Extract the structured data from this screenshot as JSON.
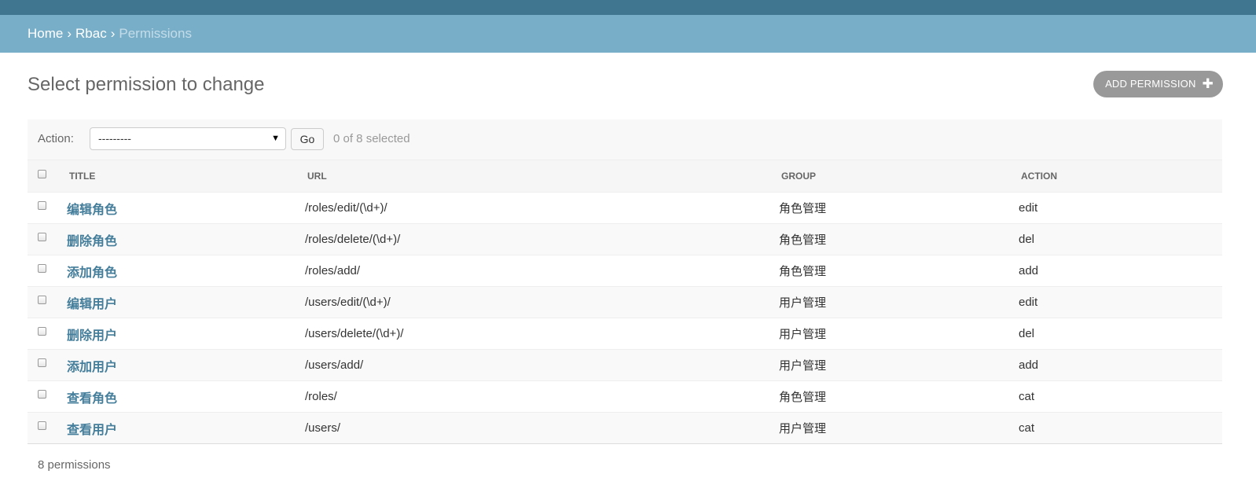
{
  "breadcrumbs": {
    "home": "Home",
    "separator": "›",
    "app": "Rbac",
    "current": "Permissions"
  },
  "page": {
    "title": "Select permission to change",
    "add_button": "ADD PERMISSION",
    "add_icon": "plus-icon"
  },
  "actions": {
    "label": "Action:",
    "select_value": "---------",
    "go_label": "Go",
    "selected_text": "0 of 8 selected"
  },
  "table": {
    "headers": [
      "TITLE",
      "URL",
      "GROUP",
      "ACTION"
    ],
    "rows": [
      {
        "title": "编辑角色",
        "url": "/roles/edit/(\\d+)/",
        "group": "角色管理",
        "action": "edit"
      },
      {
        "title": "删除角色",
        "url": "/roles/delete/(\\d+)/",
        "group": "角色管理",
        "action": "del"
      },
      {
        "title": "添加角色",
        "url": "/roles/add/",
        "group": "角色管理",
        "action": "add"
      },
      {
        "title": "编辑用户",
        "url": "/users/edit/(\\d+)/",
        "group": "用户管理",
        "action": "edit"
      },
      {
        "title": "删除用户",
        "url": "/users/delete/(\\d+)/",
        "group": "用户管理",
        "action": "del"
      },
      {
        "title": "添加用户",
        "url": "/users/add/",
        "group": "用户管理",
        "action": "add"
      },
      {
        "title": "查看角色",
        "url": "/roles/",
        "group": "角色管理",
        "action": "cat"
      },
      {
        "title": "查看用户",
        "url": "/users/",
        "group": "用户管理",
        "action": "cat"
      }
    ]
  },
  "paginator": {
    "text": "8 permissions"
  },
  "colors": {
    "header_dark": "#417690",
    "breadcrumb_bg": "#79aec8",
    "link": "#447e9b",
    "add_button_bg": "#999999"
  }
}
